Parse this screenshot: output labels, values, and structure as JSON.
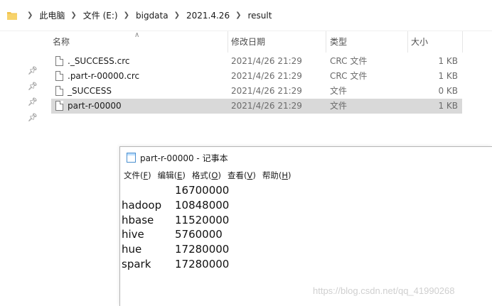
{
  "explorer": {
    "breadcrumb": [
      "此电脑",
      "文件 (E:)",
      "bigdata",
      "2021.4.26",
      "result"
    ],
    "columns": {
      "name": "名称",
      "date": "修改日期",
      "type": "类型",
      "size": "大小"
    },
    "files": [
      {
        "name": "._SUCCESS.crc",
        "date": "2021/4/26 21:29",
        "type": "CRC 文件",
        "size": "1 KB",
        "selected": false
      },
      {
        "name": ".part-r-00000.crc",
        "date": "2021/4/26 21:29",
        "type": "CRC 文件",
        "size": "1 KB",
        "selected": false
      },
      {
        "name": "_SUCCESS",
        "date": "2021/4/26 21:29",
        "type": "文件",
        "size": "0 KB",
        "selected": false
      },
      {
        "name": "part-r-00000",
        "date": "2021/4/26 21:29",
        "type": "文件",
        "size": "1 KB",
        "selected": true
      }
    ]
  },
  "notepad": {
    "title": "part-r-00000 - 记事本",
    "menu": [
      {
        "label": "文件",
        "key": "F"
      },
      {
        "label": "编辑",
        "key": "E"
      },
      {
        "label": "格式",
        "key": "O"
      },
      {
        "label": "查看",
        "key": "V"
      },
      {
        "label": "帮助",
        "key": "H"
      }
    ],
    "lines": [
      {
        "key": "",
        "value": "16700000"
      },
      {
        "key": "hadoop",
        "value": "10848000"
      },
      {
        "key": "hbase",
        "value": "11520000"
      },
      {
        "key": "hive",
        "value": "5760000"
      },
      {
        "key": "hue",
        "value": "17280000"
      },
      {
        "key": "spark",
        "value": "17280000"
      }
    ]
  },
  "watermark": "https://blog.csdn.net/qq_41990268"
}
